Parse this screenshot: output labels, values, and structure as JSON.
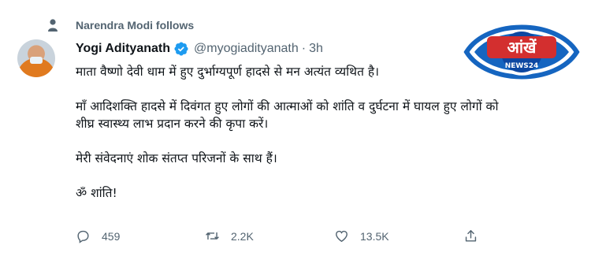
{
  "context": {
    "text": "Narendra Modi follows",
    "icon": "person-icon"
  },
  "tweet": {
    "display_name": "Yogi Adityanath",
    "handle": "@myogiadityanath",
    "separator": "·",
    "time": "3h",
    "paragraphs": [
      "माता वैष्णो देवी धाम में हुए दुर्भाग्यपूर्ण हादसे से मन अत्यंत व्यथित है।",
      "माँ आदिशक्ति हादसे में दिवंगत हुए लोगों की आत्माओं को शांति व दुर्घटना में घायल हुए लोगों को शीघ्र स्वास्थ्य लाभ प्रदान करने की कृपा करें।",
      "मेरी संवेदनाएं शोक संतप्त परिजनों के साथ हैं।",
      "ॐ शांति!"
    ]
  },
  "actions": {
    "reply_count": "459",
    "retweet_count": "2.2K",
    "like_count": "13.5K"
  },
  "logo": {
    "main": "आंखें",
    "sub": "NEWS24"
  },
  "colors": {
    "accent": "#1d9bf0",
    "muted": "#536471",
    "logo_blue": "#1565c0",
    "logo_red": "#d32f2f"
  }
}
